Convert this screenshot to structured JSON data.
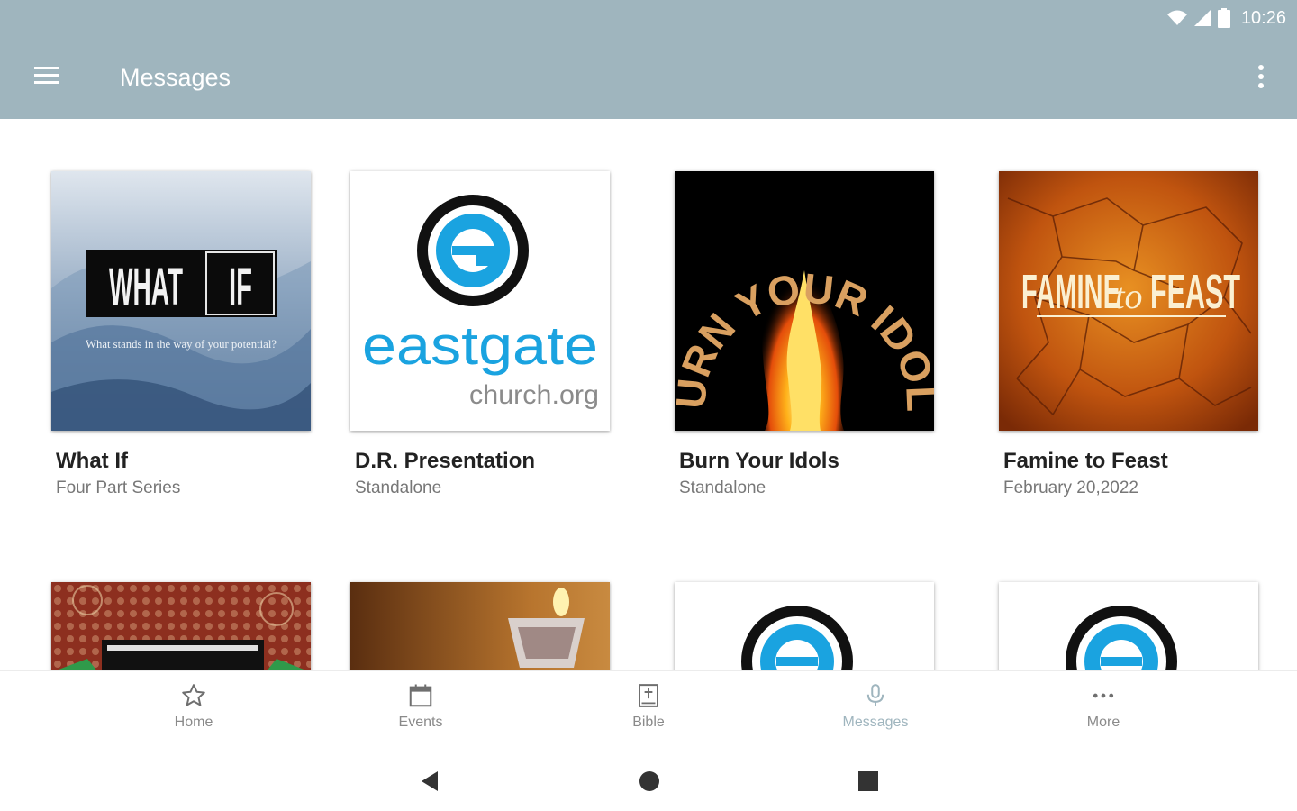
{
  "status_bar": {
    "time": "10:26"
  },
  "app_bar": {
    "title": "Messages"
  },
  "messages": [
    {
      "title": "What If",
      "subtitle": "Four Part Series",
      "art": {
        "line1": "WHAT",
        "line2": "IF",
        "tagline": "What stands in the way of your potential?"
      }
    },
    {
      "title": "D.R. Presentation",
      "subtitle": "Standalone",
      "art": {
        "line1": "eastgate",
        "line2": "church.org"
      }
    },
    {
      "title": "Burn Your Idols",
      "subtitle": "Standalone",
      "art": {
        "text": "BURN YOUR IDOLS"
      }
    },
    {
      "title": "Famine to Feast",
      "subtitle": "February 20,2022",
      "art": {
        "line1": "FAMINE",
        "line2": "to",
        "line3": "FEAST"
      }
    }
  ],
  "bottom_nav": [
    {
      "label": "Home",
      "icon": "star-icon"
    },
    {
      "label": "Events",
      "icon": "calendar-icon"
    },
    {
      "label": "Bible",
      "icon": "bible-icon"
    },
    {
      "label": "Messages",
      "icon": "microphone-icon",
      "active": true
    },
    {
      "label": "More",
      "icon": "more-dots-icon"
    }
  ],
  "colors": {
    "app_bar": "#9fb5be",
    "eastgate_blue": "#1aa3e0",
    "active_nav": "#9fb5be"
  }
}
